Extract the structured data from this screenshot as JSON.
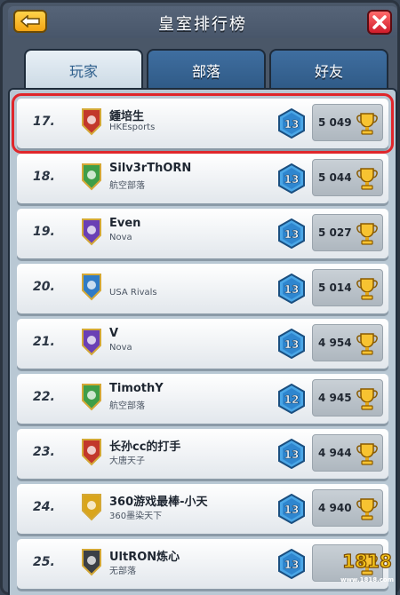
{
  "header": {
    "title": "皇室排行榜",
    "back_icon": "back-arrow-icon",
    "close_icon": "close-x-icon"
  },
  "tabs": [
    {
      "label": "玩家",
      "active": true
    },
    {
      "label": "部落",
      "active": false
    },
    {
      "label": "好友",
      "active": false
    }
  ],
  "colors": {
    "accent": "#f3a514",
    "highlight": "#e0262b",
    "tab_blue": "#2f5a86"
  },
  "players": [
    {
      "rank": "17.",
      "name": "鍾培生",
      "clan": "HKEsports",
      "level": "13",
      "trophies": "5 049",
      "badge_color": "#c2372b",
      "badge_icon": "flame-clan-icon"
    },
    {
      "rank": "18.",
      "name": "Silv3rThORN",
      "clan": "航空部落",
      "level": "13",
      "trophies": "5 044",
      "badge_color": "#3e9e48",
      "badge_icon": "leaf-clan-icon"
    },
    {
      "rank": "19.",
      "name": "Even",
      "clan": "Nova",
      "level": "13",
      "trophies": "5 027",
      "badge_color": "#6a3fb5",
      "badge_icon": "star-clan-icon"
    },
    {
      "rank": "20.",
      "name": "",
      "clan": "USA Rivals",
      "level": "13",
      "trophies": "5 014",
      "badge_color": "#2f7bc6",
      "badge_icon": "rocket-clan-icon"
    },
    {
      "rank": "21.",
      "name": "V",
      "clan": "Nova",
      "level": "13",
      "trophies": "4 954",
      "badge_color": "#6a3fb5",
      "badge_icon": "star-clan-icon"
    },
    {
      "rank": "22.",
      "name": "TimothY",
      "clan": "航空部落",
      "level": "12",
      "trophies": "4 945",
      "badge_color": "#3e9e48",
      "badge_icon": "leaf-clan-icon"
    },
    {
      "rank": "23.",
      "name": "长孙cc的打手",
      "clan": "大唐天子",
      "level": "13",
      "trophies": "4 944",
      "badge_color": "#c2372b",
      "badge_icon": "flame-clan-icon"
    },
    {
      "rank": "24.",
      "name": "360游戏最棒-小天",
      "clan": "360墨染天下",
      "level": "13",
      "trophies": "4 940",
      "badge_color": "#d9a51c",
      "badge_icon": "skull-clan-icon"
    },
    {
      "rank": "25.",
      "name": "UltRON炼心",
      "clan": "无部落",
      "level": "13",
      "trophies": "",
      "badge_color": "#3b3f46",
      "badge_icon": "empty-clan-icon"
    }
  ],
  "watermark": {
    "top": "1818",
    "bottom": "www.1818.com"
  }
}
